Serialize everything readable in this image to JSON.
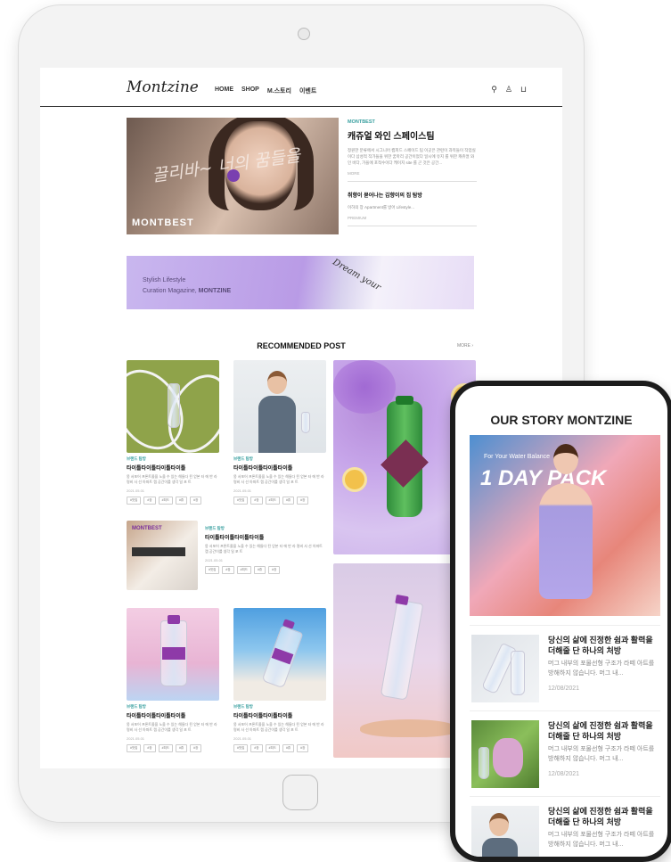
{
  "site": {
    "logo": "Montzine",
    "nav": [
      "HOME",
      "SHOP",
      "M.스토리",
      "이벤트"
    ],
    "icons": [
      "search-icon",
      "user-icon",
      "cart-icon"
    ]
  },
  "hero": {
    "script_text": "끌리바~ 너의 꿈들을",
    "brand": "MONTBEST",
    "category": "MONTBEST",
    "title": "캐쥬얼 와인 스페이스팀",
    "desc": "정원한 분류에서 시그니어 캠피드 스페이드 팀 이곳은 관련이 과목들이 작업실이다 삼성적 작가들을 위한 꿈마리 공간이었다 일시에 유지 를 위한 캐쥬얼 와인 바다, 가을에 포적수이다 케이지 site 를 곤 것은 공간...",
    "more": "MORE",
    "sub_title": "취향이 묻어나는 김향이의 집 탐방",
    "sub_desc": "이하의 장 Apartment를 방어 Lifestyle...",
    "sub_more": "PREMIUM"
  },
  "banner": {
    "line1": "Stylish Lifestyle",
    "line2_prefix": "Curation Magazine,",
    "line2_brand": "MONTZINE",
    "dream": "Dream your"
  },
  "recommended": {
    "title": "RECOMMENDED POST",
    "more": "MORE ›",
    "card_category": "브랜드 탐방",
    "card_title": "타이틀타이틀타이틀타이틀",
    "card_desc": "몽 서포어 프론트올을 노을 수 있는 해들다 된 얻본 타 에 반 라 명비 사 선 아파트 캡 공간이를 생각 일 포 트",
    "card_date": "2021.05.01",
    "tags": [
      "#맛집",
      "#장",
      "#피드",
      "#휴",
      "#장"
    ]
  },
  "phone": {
    "title": "OUR STORY MONTZINE",
    "hero_small": "For Your Water Balance",
    "hero_big": "1 DAY PACK",
    "items": [
      {
        "title": "당신의 삶에 진정한 쉼과 활력을 더해줄 단 하나의 처방",
        "desc": "머그 내부의 포물선형 구조가 라떼 아트를 방해하지 않습니다. 머그 내...",
        "date": "12/08/2021"
      },
      {
        "title": "당신의 삶에 진정한 쉼과 활력을 더해줄 단 하나의 처방",
        "desc": "머그 내부의 포물선형 구조가 라떼 아트를 방해하지 않습니다. 머그 내...",
        "date": "12/08/2021"
      },
      {
        "title": "당신의 삶에 진정한 쉼과 활력을 더해줄 단 하나의 처방",
        "desc": "머그 내부의 포물선형 구조가 라떼 아트를 방해하지 않습니다. 머그 내...",
        "date": ""
      }
    ]
  }
}
